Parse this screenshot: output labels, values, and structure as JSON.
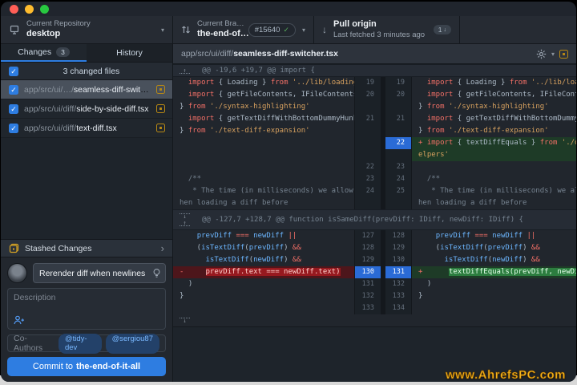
{
  "icons": {
    "caret": "▾",
    "chevron": "›",
    "check": "✓",
    "arrow_down": "↓",
    "arrow_up": "↑"
  },
  "colors": {
    "accent_blue": "#2e7de1",
    "added_green": "#2c7d3f",
    "deleted_red": "#97191f",
    "modified_yellow": "#b88914",
    "selected_gutter_blue": "#2a6bd6",
    "traffic_red": "#ff5f57",
    "traffic_yellow": "#febc2e",
    "traffic_green": "#28c840"
  },
  "toolbar": {
    "repo": {
      "label": "Current Repository",
      "value": "desktop"
    },
    "branch": {
      "label": "Current Bra…",
      "value": "the-end-of…",
      "pr_badge": "#15640"
    },
    "pull": {
      "title": "Pull origin",
      "subtitle": "Last fetched 3 minutes ago",
      "badge": "1"
    }
  },
  "sidebar": {
    "tabs": [
      {
        "label": "Changes",
        "count": "3"
      },
      {
        "label": "History"
      }
    ],
    "files_header": "3 changed files",
    "files": [
      {
        "prefix": "app/src/ui/…/",
        "name": "seamless-diff-switcher.tsx",
        "selected": true
      },
      {
        "prefix": "app/src/ui/diff/",
        "name": "side-by-side-diff.tsx",
        "selected": false
      },
      {
        "prefix": "app/src/ui/diff/",
        "name": "text-diff.tsx",
        "selected": false
      }
    ],
    "stashed": "Stashed Changes",
    "commit": {
      "summary": "Rerender diff when newlines are adde",
      "description_placeholder": "Description",
      "coauthors_label": "Co-Authors",
      "coauthors": [
        "@tidy-dev",
        "@sergiou87"
      ],
      "button_prefix": "Commit to ",
      "button_branch": "the-end-of-it-all"
    }
  },
  "diff": {
    "file_path_prefix": "app/src/ui/diff/",
    "file_name": "seamless-diff-switcher.tsx",
    "rows": [
      {
        "t": "hunk",
        "icons": [
          "up"
        ],
        "text": "@@ -19,6 +19,7 @@ import {"
      },
      {
        "t": "code",
        "ln": "19",
        "rn": "19",
        "l": [
          [
            "p",
            "  "
          ],
          [
            "k",
            "import"
          ],
          [
            "p",
            " { Loading } "
          ],
          [
            "k",
            "from"
          ],
          [
            "p",
            " "
          ],
          [
            "s",
            "'../lib/loading'"
          ]
        ],
        "r": [
          [
            "p",
            "  "
          ],
          [
            "k",
            "import"
          ],
          [
            "p",
            " { Loading } "
          ],
          [
            "k",
            "from"
          ],
          [
            "p",
            " "
          ],
          [
            "s",
            "'../lib/loading'"
          ]
        ]
      },
      {
        "t": "code",
        "ln": "20",
        "rn": "20",
        "l": [
          [
            "p",
            "  "
          ],
          [
            "k",
            "import"
          ],
          [
            "p",
            " { getFileContents, IFileContents"
          ]
        ],
        "r": [
          [
            "p",
            "  "
          ],
          [
            "k",
            "import"
          ],
          [
            "p",
            " { getFileContents, IFileContents"
          ]
        ]
      },
      {
        "t": "code",
        "l": [
          [
            "p",
            "} "
          ],
          [
            "k",
            "from"
          ],
          [
            "p",
            " "
          ],
          [
            "s",
            "'./syntax-highlighting'"
          ]
        ],
        "r": [
          [
            "p",
            "} "
          ],
          [
            "k",
            "from"
          ],
          [
            "p",
            " "
          ],
          [
            "s",
            "'./syntax-highlighting'"
          ]
        ]
      },
      {
        "t": "code",
        "ln": "21",
        "rn": "21",
        "l": [
          [
            "p",
            "  "
          ],
          [
            "k",
            "import"
          ],
          [
            "p",
            " { getTextDiffWithBottomDummyHunk"
          ]
        ],
        "r": [
          [
            "p",
            "  "
          ],
          [
            "k",
            "import"
          ],
          [
            "p",
            " { getTextDiffWithBottomDummyHunk"
          ]
        ]
      },
      {
        "t": "code",
        "l": [
          [
            "p",
            "} "
          ],
          [
            "k",
            "from"
          ],
          [
            "p",
            " "
          ],
          [
            "s",
            "'./text-diff-expansion'"
          ]
        ],
        "r": [
          [
            "p",
            "} "
          ],
          [
            "k",
            "from"
          ],
          [
            "p",
            " "
          ],
          [
            "s",
            "'./text-diff-expansion'"
          ]
        ]
      },
      {
        "t": "code",
        "rn": "22",
        "rsel": true,
        "rk": "add",
        "l": [],
        "r": [
          [
            "k",
            "+ "
          ],
          [
            "k",
            "import"
          ],
          [
            "p",
            " { textDiffEquals } "
          ],
          [
            "k",
            "from"
          ],
          [
            "p",
            " "
          ],
          [
            "s",
            "'./diff-h"
          ]
        ]
      },
      {
        "t": "code",
        "rk": "add",
        "l": [],
        "r": [
          [
            "s",
            "elpers'"
          ]
        ]
      },
      {
        "t": "code",
        "ln": "22",
        "rn": "23",
        "l": [],
        "r": []
      },
      {
        "t": "code",
        "ln": "23",
        "rn": "24",
        "l": [
          [
            "c",
            "  /**"
          ]
        ],
        "r": [
          [
            "c",
            "  /**"
          ]
        ]
      },
      {
        "t": "code",
        "ln": "24",
        "rn": "25",
        "l": [
          [
            "c",
            "   * The time (in milliseconds) we allow w"
          ]
        ],
        "r": [
          [
            "c",
            "   * The time (in milliseconds) we allow w"
          ]
        ]
      },
      {
        "t": "code",
        "l": [
          [
            "c",
            "hen loading a diff before"
          ]
        ],
        "r": [
          [
            "c",
            "hen loading a diff before"
          ]
        ]
      },
      {
        "t": "hunk",
        "tall": true,
        "icons": [
          "down",
          "up"
        ],
        "text": "@@ -127,7 +128,7 @@ function isSameDiff(prevDiff: IDiff, newDiff: IDiff) {"
      },
      {
        "t": "code",
        "ln": "127",
        "rn": "128",
        "l": [
          [
            "p",
            "    "
          ],
          [
            "v",
            "prevDiff"
          ],
          [
            "p",
            " "
          ],
          [
            "k",
            "==="
          ],
          [
            "p",
            " "
          ],
          [
            "v",
            "newDiff"
          ],
          [
            "p",
            " "
          ],
          [
            "k",
            "||"
          ]
        ],
        "r": [
          [
            "p",
            "    "
          ],
          [
            "v",
            "prevDiff"
          ],
          [
            "p",
            " "
          ],
          [
            "k",
            "==="
          ],
          [
            "p",
            " "
          ],
          [
            "v",
            "newDiff"
          ],
          [
            "p",
            " "
          ],
          [
            "k",
            "||"
          ]
        ]
      },
      {
        "t": "code",
        "ln": "128",
        "rn": "129",
        "l": [
          [
            "p",
            "    ("
          ],
          [
            "v",
            "isTextDiff"
          ],
          [
            "p",
            "("
          ],
          [
            "v",
            "prevDiff"
          ],
          [
            "p",
            ") "
          ],
          [
            "k",
            "&&"
          ]
        ],
        "r": [
          [
            "p",
            "    ("
          ],
          [
            "v",
            "isTextDiff"
          ],
          [
            "p",
            "("
          ],
          [
            "v",
            "prevDiff"
          ],
          [
            "p",
            ") "
          ],
          [
            "k",
            "&&"
          ]
        ]
      },
      {
        "t": "code",
        "ln": "129",
        "rn": "130",
        "l": [
          [
            "p",
            "      "
          ],
          [
            "v",
            "isTextDiff"
          ],
          [
            "p",
            "("
          ],
          [
            "v",
            "newDiff"
          ],
          [
            "p",
            ") "
          ],
          [
            "k",
            "&&"
          ]
        ],
        "r": [
          [
            "p",
            "      "
          ],
          [
            "v",
            "isTextDiff"
          ],
          [
            "p",
            "("
          ],
          [
            "v",
            "newDiff"
          ],
          [
            "p",
            ") "
          ],
          [
            "k",
            "&&"
          ]
        ]
      },
      {
        "t": "code",
        "ln": "130",
        "rn": "131",
        "lsel": true,
        "rsel": true,
        "lk": "del",
        "rk": "add",
        "l": [
          [
            "k",
            "-"
          ],
          [
            "p",
            "     "
          ],
          [
            "xd",
            "prevDiff.text === newDiff.text)"
          ]
        ],
        "r": [
          [
            "k",
            "+"
          ],
          [
            "p",
            "      "
          ],
          [
            "xa",
            "textDiffEquals(prevDiff, newDiff)"
          ],
          [
            "p",
            ")"
          ]
        ]
      },
      {
        "t": "code",
        "ln": "131",
        "rn": "132",
        "l": [
          [
            "p",
            "  )"
          ]
        ],
        "r": [
          [
            "p",
            "  )"
          ]
        ]
      },
      {
        "t": "code",
        "ln": "132",
        "rn": "133",
        "l": [
          [
            "p",
            "}"
          ]
        ],
        "r": [
          [
            "p",
            "}"
          ]
        ]
      },
      {
        "t": "code",
        "ln": "133",
        "rn": "134",
        "l": [],
        "r": []
      },
      {
        "t": "expand",
        "icons": [
          "down"
        ]
      }
    ]
  },
  "watermark": "www.AhrefsPC.com"
}
